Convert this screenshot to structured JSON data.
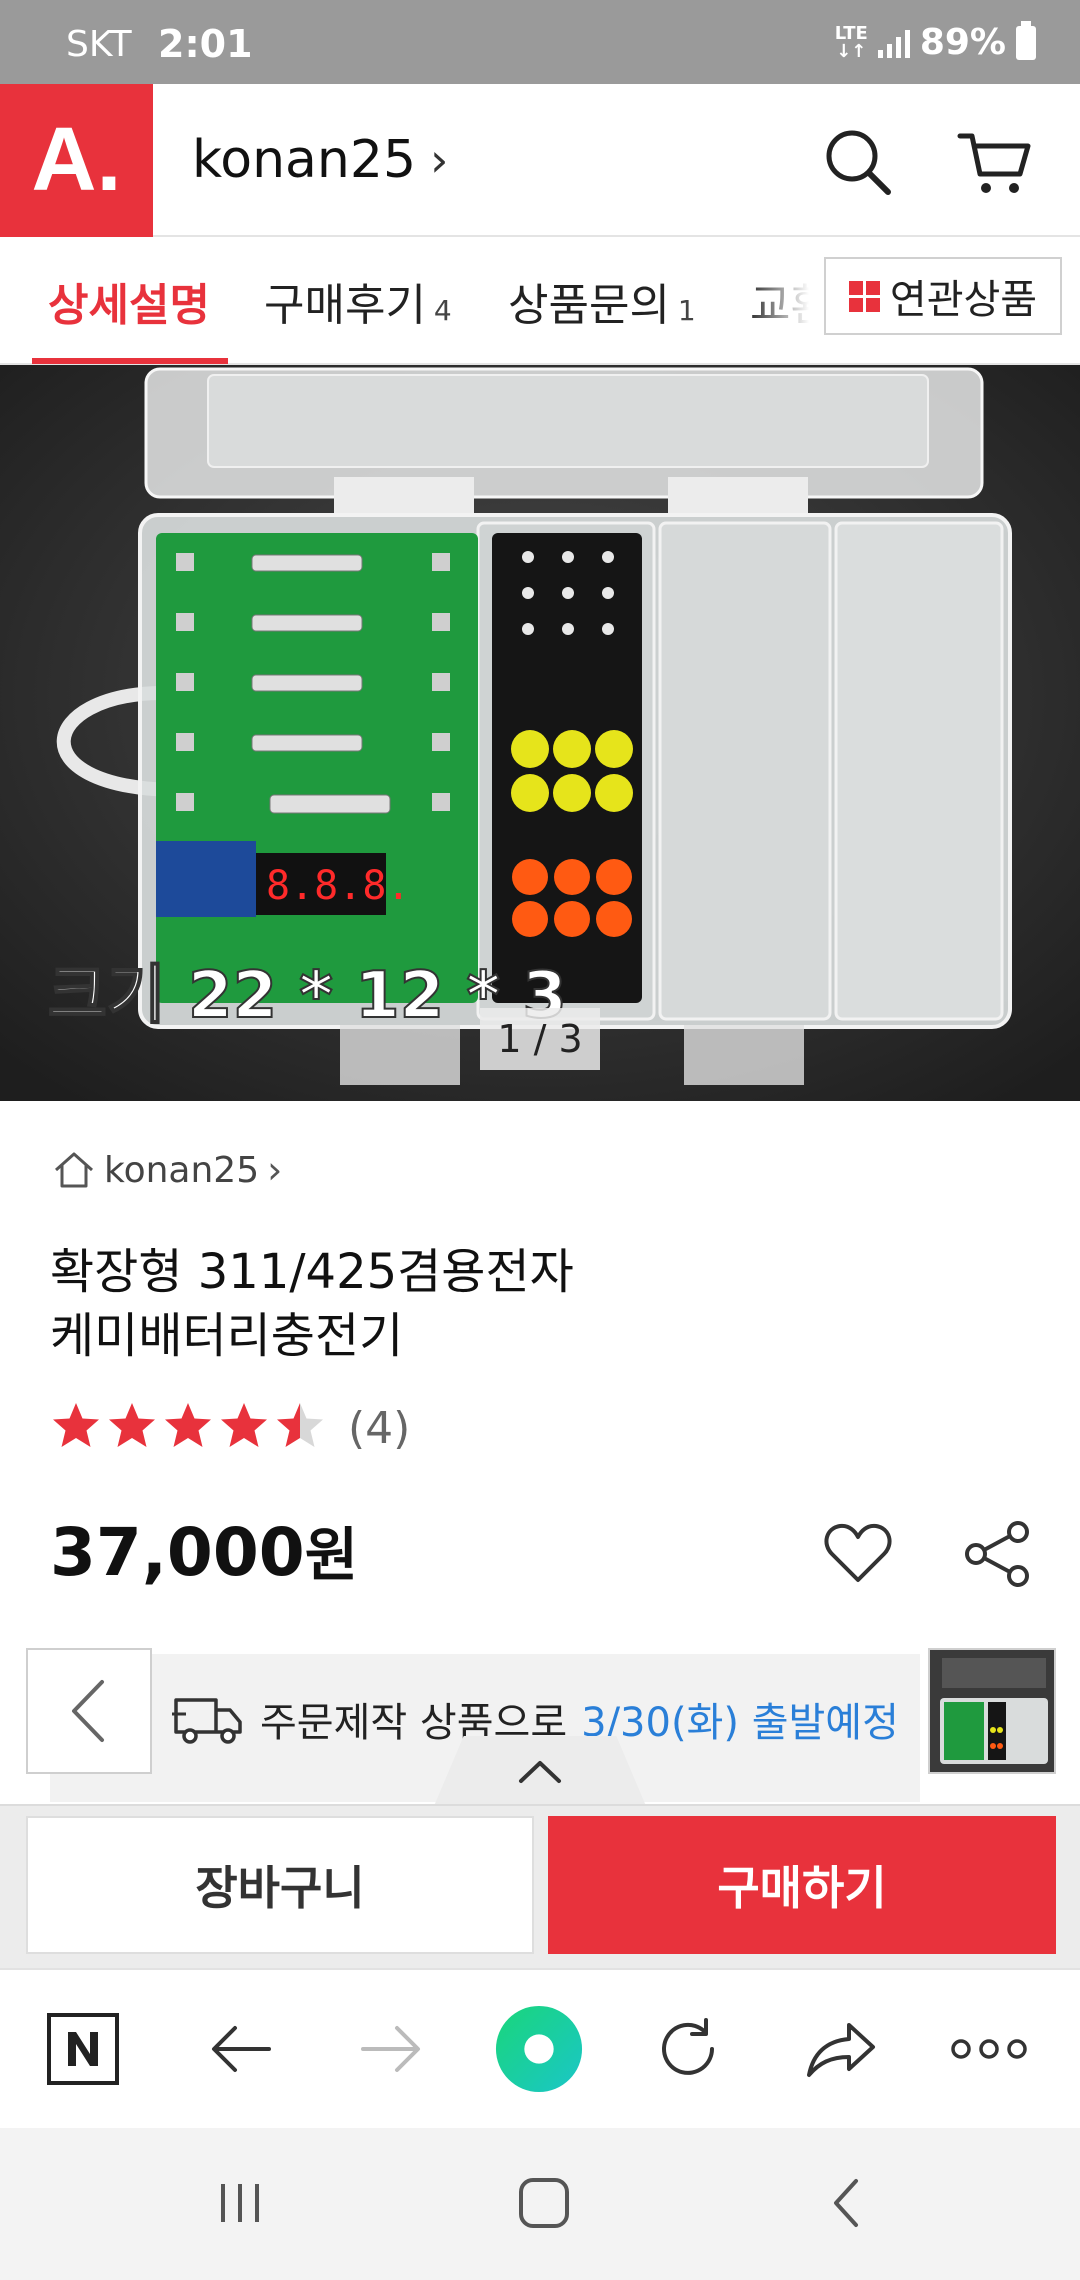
{
  "status_bar": {
    "carrier": "SKT",
    "time": "2:01",
    "network": "LTE",
    "battery": "89%"
  },
  "header": {
    "logo_text": "A.",
    "seller_name": "konan25",
    "seller_chevron": "›"
  },
  "tabs": {
    "items": [
      {
        "label": "상세설명",
        "count": ""
      },
      {
        "label": "구매후기",
        "count": "4"
      },
      {
        "label": "상품문의",
        "count": "1"
      },
      {
        "label": "교환",
        "count": ""
      }
    ],
    "related_label": "연관상품",
    "accent_color": "#e8323c"
  },
  "product_image": {
    "overlay_text": "크기 22 * 12 * 3",
    "counter": "1 / 3",
    "display_text": "8.8.8."
  },
  "product": {
    "seller": "konan25",
    "seller_chevron": "›",
    "title_line1": "확장형 311/425겸용전자",
    "title_line2": "케미배터리충전기",
    "rating": 4.5,
    "rating_max": 5,
    "review_count": "(4)",
    "price": "37,000",
    "currency": "원"
  },
  "shipping": {
    "prefix": "주문제작 상품으로",
    "date": "3/30(화)",
    "suffix": "출발예정"
  },
  "bottom_sheet": {
    "cart_label": "장바구니",
    "buy_label": "구매하기"
  },
  "browser_toolbar": {
    "icons": [
      "naver-n-icon",
      "back-arrow-icon",
      "forward-arrow-icon",
      "green-dot-icon",
      "refresh-icon",
      "share-arrow-icon",
      "more-icon"
    ]
  },
  "system_nav": {
    "icons": [
      "recent-apps-icon",
      "home-icon",
      "back-icon"
    ]
  }
}
